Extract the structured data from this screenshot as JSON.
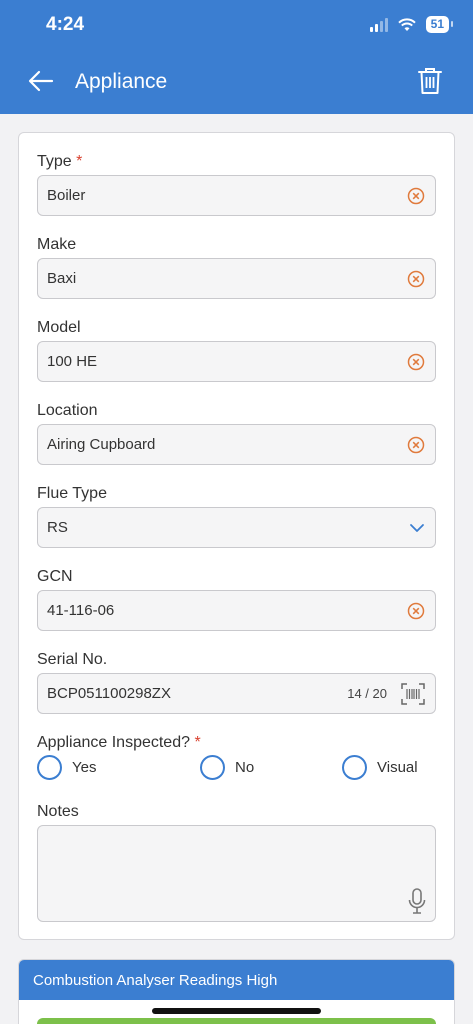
{
  "status_bar": {
    "time": "4:24",
    "battery": "51"
  },
  "header": {
    "title": "Appliance"
  },
  "fields": [
    {
      "label": "Type",
      "required": "*",
      "value": "Boiler"
    },
    {
      "label": "Make",
      "value": "Baxi"
    },
    {
      "label": "Model",
      "value": "100 HE"
    },
    {
      "label": "Location",
      "value": "Airing Cupboard"
    },
    {
      "label": "Flue Type",
      "value": "RS"
    },
    {
      "label": "GCN",
      "value": "41-116-06"
    },
    {
      "label": "Serial No.",
      "value": "BCP051100298ZX",
      "counter": "14 / 20"
    }
  ],
  "inspected": {
    "label": "Appliance Inspected?",
    "required": "*",
    "options": [
      "Yes",
      "No",
      "Visual"
    ]
  },
  "notes": {
    "label": "Notes",
    "value": ""
  },
  "section": {
    "title": "Combustion Analyser Readings High"
  },
  "colors": {
    "primary": "#3b7ed1",
    "clear_icon": "#e07a3c",
    "required": "#d9412f",
    "success": "#7cc04a"
  }
}
